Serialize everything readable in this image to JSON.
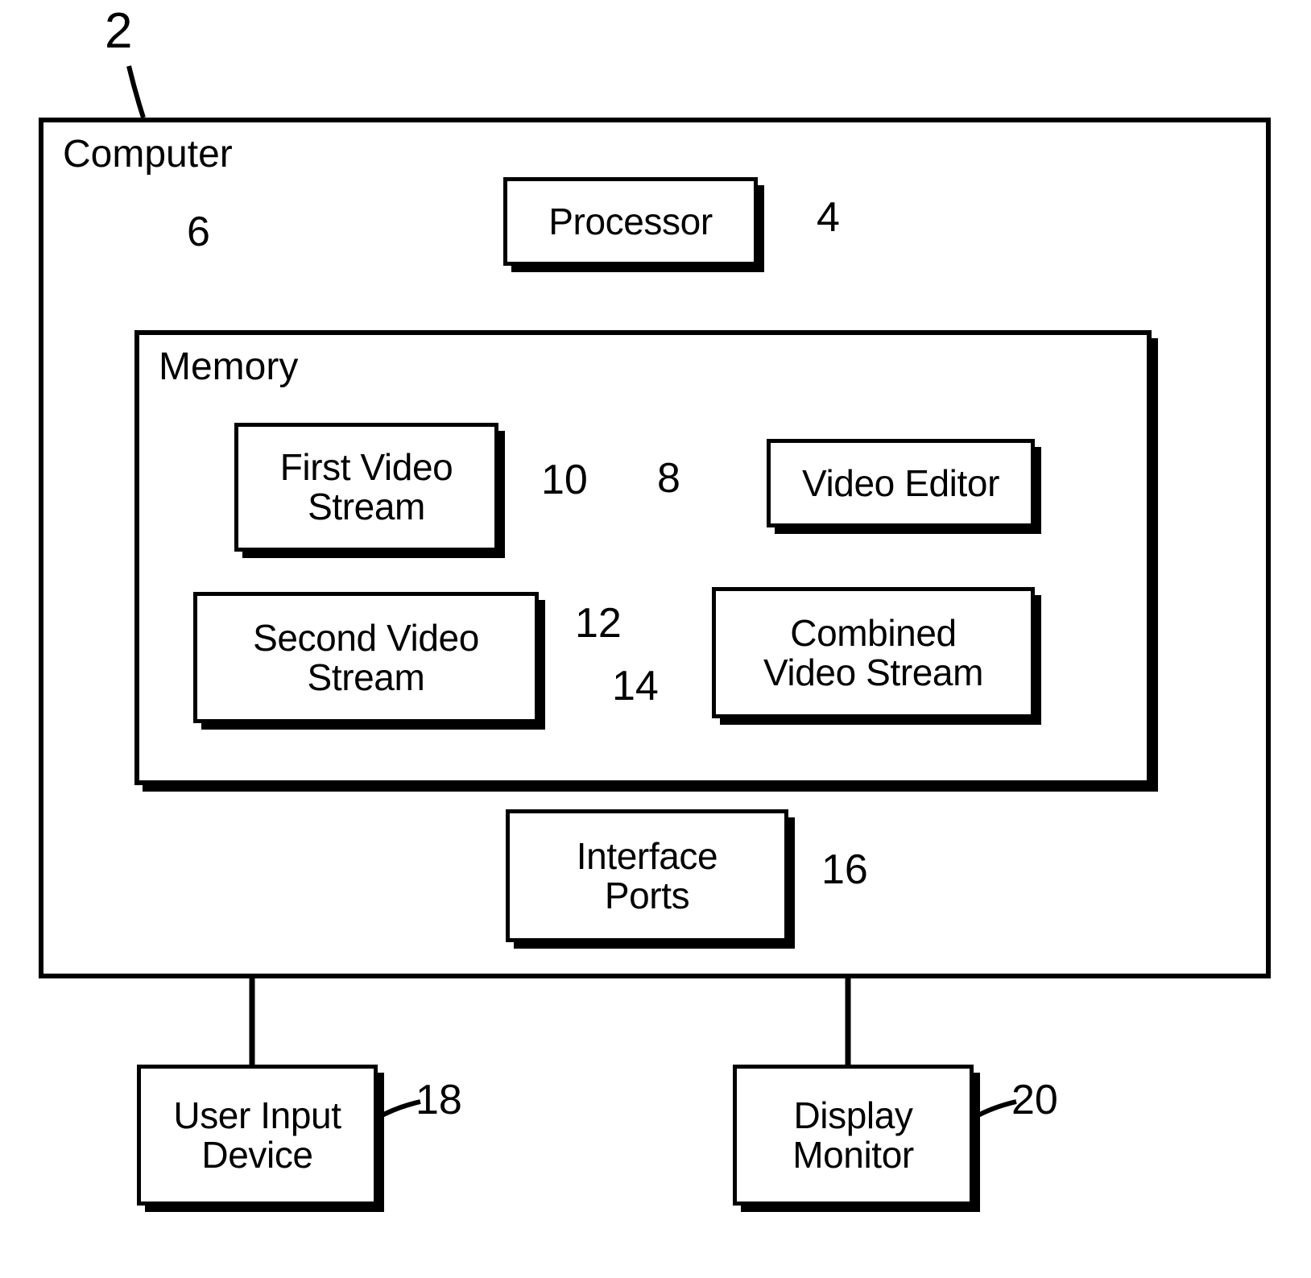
{
  "figure": {
    "type": "patent-block-diagram",
    "background_color": "#ffffff",
    "line_color": "#000000"
  },
  "containers": [
    {
      "key": "computer",
      "title": "Computer",
      "ref": "2"
    },
    {
      "key": "memory",
      "title": "Memory",
      "ref": "6"
    }
  ],
  "nodes": [
    {
      "key": "processor",
      "label": "Processor",
      "ref": "4"
    },
    {
      "key": "first_video_stream",
      "label": "First Video\nStream",
      "ref": "10"
    },
    {
      "key": "video_editor",
      "label": "Video Editor",
      "ref": "8"
    },
    {
      "key": "second_video_stream",
      "label": "Second Video\nStream",
      "ref": "12"
    },
    {
      "key": "combined_video_stream",
      "label": "Combined\nVideo Stream",
      "ref": "14"
    },
    {
      "key": "interface_ports",
      "label": "Interface\nPorts",
      "ref": "16"
    },
    {
      "key": "user_input_device",
      "label": "User Input\nDevice",
      "ref": "18"
    },
    {
      "key": "display_monitor",
      "label": "Display\nMonitor",
      "ref": "20"
    }
  ],
  "labels": {
    "computer_title": "Computer",
    "memory_title": "Memory",
    "processor": "Processor",
    "first_video_stream": "First Video\nStream",
    "video_editor": "Video Editor",
    "second_video_stream": "Second Video\nStream",
    "combined_video_stream": "Combined\nVideo Stream",
    "interface_ports": "Interface\nPorts",
    "user_input_device": "User Input\nDevice",
    "display_monitor": "Display\nMonitor"
  },
  "refs": {
    "computer": "2",
    "processor": "4",
    "memory": "6",
    "video_editor": "8",
    "first_video_stream": "10",
    "second_video_stream": "12",
    "combined_video_stream": "14",
    "interface_ports": "16",
    "user_input_device": "18",
    "display_monitor": "20"
  }
}
